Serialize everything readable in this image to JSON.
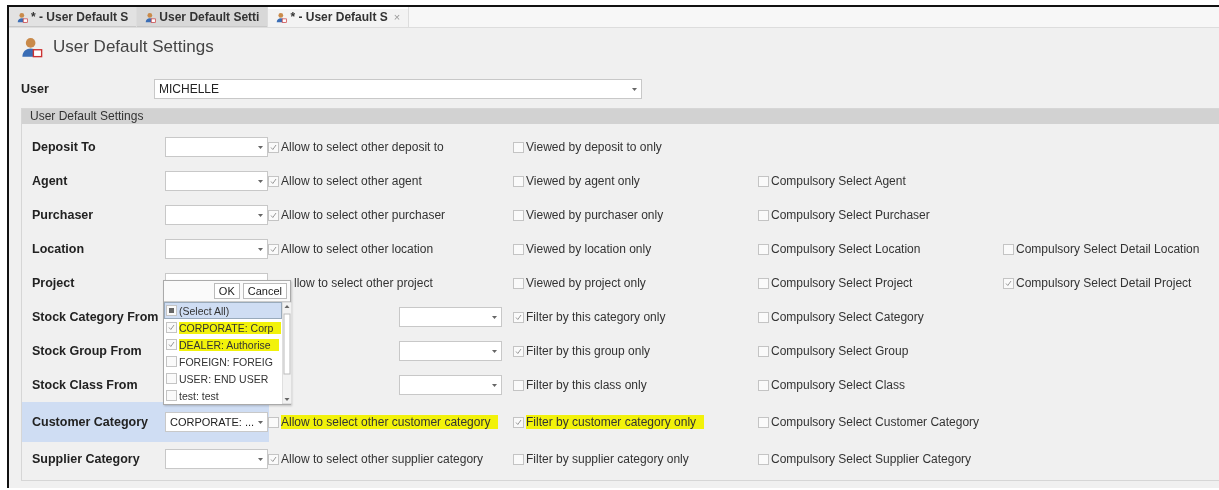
{
  "tabs": [
    {
      "label": "* - User Default S",
      "selected": false
    },
    {
      "label": "User Default Setti",
      "selected": false
    },
    {
      "label": "* - User Default S",
      "selected": true,
      "close": "×"
    }
  ],
  "page_title": "User Default Settings",
  "user": {
    "label": "User",
    "value": "MICHELLE"
  },
  "group": {
    "title": "User Default Settings",
    "rows": [
      {
        "kind": "standard",
        "label": "Deposit To",
        "selected": false,
        "checks": [
          {
            "label": "Allow to select other deposit to",
            "checked": true,
            "highlighted": false
          },
          {
            "label": "Viewed by deposit to only",
            "checked": false,
            "highlighted": false
          }
        ]
      },
      {
        "kind": "standard",
        "label": "Agent",
        "selected": false,
        "checks": [
          {
            "label": "Allow to select other agent",
            "checked": true,
            "highlighted": false
          },
          {
            "label": "Viewed by agent only",
            "checked": false,
            "highlighted": false
          },
          {
            "label": "Compulsory Select Agent",
            "checked": false,
            "highlighted": false
          }
        ]
      },
      {
        "kind": "standard",
        "label": "Purchaser",
        "selected": false,
        "checks": [
          {
            "label": "Allow to select other purchaser",
            "checked": true,
            "highlighted": false
          },
          {
            "label": "Viewed by purchaser only",
            "checked": false,
            "highlighted": false
          },
          {
            "label": "Compulsory Select Purchaser",
            "checked": false,
            "highlighted": false
          }
        ]
      },
      {
        "kind": "standard",
        "label": "Location",
        "selected": false,
        "checks": [
          {
            "label": "Allow to select other location",
            "checked": true,
            "highlighted": false
          },
          {
            "label": "Viewed by location only",
            "checked": false,
            "highlighted": false
          },
          {
            "label": "Compulsory Select Location",
            "checked": false,
            "highlighted": false
          },
          {
            "label": "Compulsory Select Detail Location",
            "checked": false,
            "highlighted": false
          }
        ]
      },
      {
        "kind": "standard",
        "label": "Project",
        "selected": false,
        "checks": [
          {
            "label": "llow to select other project",
            "highlighted": false
          },
          {
            "label": "Viewed by project only",
            "checked": false,
            "highlighted": false
          },
          {
            "label": "Compulsory Select Project",
            "checked": false,
            "highlighted": false
          },
          {
            "label": "Compulsory Select Detail Project",
            "checked": true,
            "highlighted": false
          }
        ],
        "popup": {
          "buttons": [
            "OK",
            "Cancel"
          ],
          "items": [
            {
              "label": "(Select All)",
              "checked": false,
              "indeterminate": true,
              "selected": true,
              "highlighted": false
            },
            {
              "label": "CORPORATE: Corp",
              "checked": true,
              "indeterminate": false,
              "selected": false,
              "highlighted": true
            },
            {
              "label": "DEALER: Authorise",
              "checked": true,
              "indeterminate": false,
              "selected": false,
              "highlighted": true
            },
            {
              "label": "FOREIGN: FOREIG",
              "checked": false,
              "indeterminate": false,
              "selected": false,
              "highlighted": false
            },
            {
              "label": "USER: END USER",
              "checked": false,
              "indeterminate": false,
              "selected": false,
              "highlighted": false
            },
            {
              "label": "test: test",
              "checked": false,
              "indeterminate": false,
              "selected": false,
              "highlighted": false
            }
          ]
        }
      },
      {
        "kind": "range",
        "label": "Stock Category From",
        "selected": false,
        "checks": [
          {
            "label": "Filter by this category only",
            "checked": true,
            "highlighted": false
          },
          {
            "label": "Compulsory Select Category",
            "checked": false,
            "highlighted": false
          }
        ]
      },
      {
        "kind": "range",
        "label": "Stock Group From",
        "selected": false,
        "checks": [
          {
            "label": "Filter by this group only",
            "checked": true,
            "highlighted": false
          },
          {
            "label": "Compulsory Select Group",
            "checked": false,
            "highlighted": false
          }
        ]
      },
      {
        "kind": "range",
        "label": "Stock Class From",
        "selected": false,
        "checks": [
          {
            "label": "Filter by this class only",
            "checked": false,
            "highlighted": false
          },
          {
            "label": "Compulsory Select Class",
            "checked": false,
            "highlighted": false
          }
        ]
      },
      {
        "kind": "standard",
        "label": "Customer Category",
        "selected": true,
        "value": "CORPORATE: ...",
        "checks": [
          {
            "label": "Allow to select other customer category",
            "checked": false,
            "highlighted": true
          },
          {
            "label": "Filter by customer category only",
            "checked": true,
            "highlighted": true
          },
          {
            "label": "Compulsory Select Customer Category",
            "checked": false,
            "highlighted": false
          }
        ]
      },
      {
        "kind": "standard",
        "label": "Supplier Category",
        "selected": false,
        "checks": [
          {
            "label": "Allow to select other supplier category",
            "checked": true,
            "highlighted": false
          },
          {
            "label": "Filter by supplier category only",
            "checked": false,
            "highlighted": false
          },
          {
            "label": "Compulsory Select Supplier Category",
            "checked": false,
            "highlighted": false
          }
        ]
      }
    ]
  }
}
